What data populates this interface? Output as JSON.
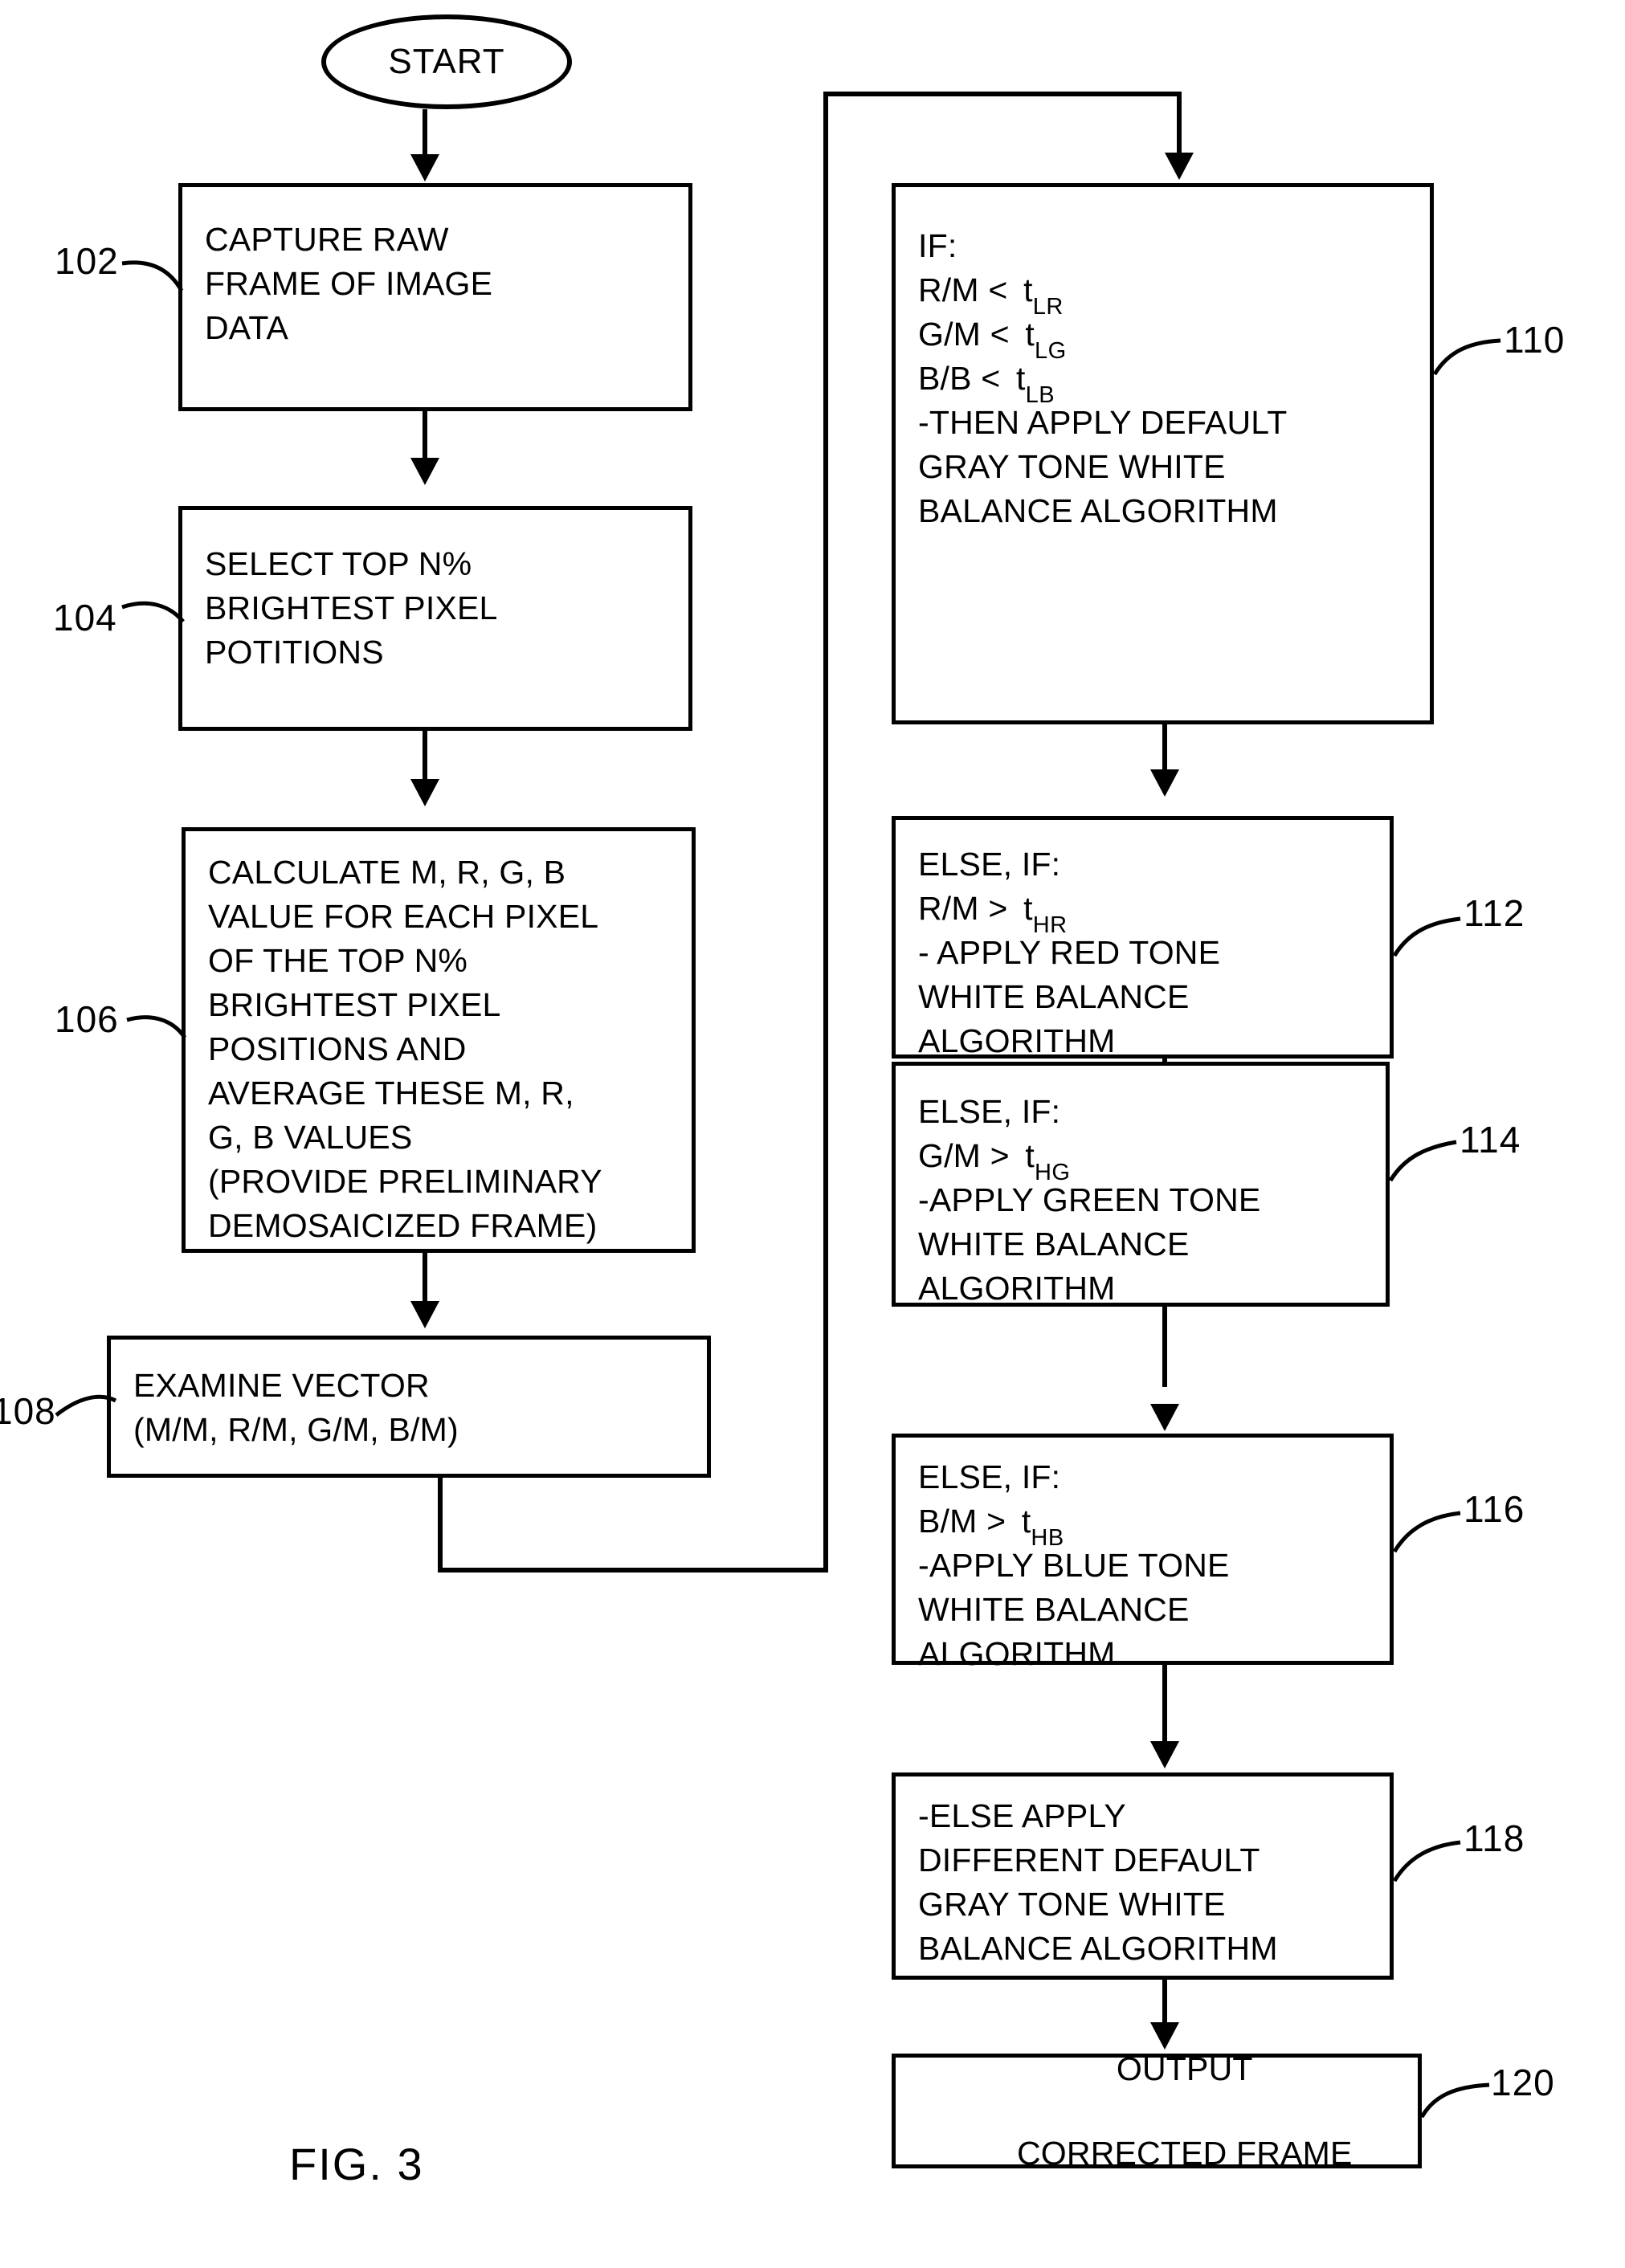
{
  "figure": {
    "caption": "FIG. 3"
  },
  "start_node": {
    "label": "START"
  },
  "left_column": [
    {
      "numeral": "102",
      "lines": [
        "CAPTURE RAW",
        "FRAME OF IMAGE",
        "DATA"
      ]
    },
    {
      "numeral": "104",
      "lines": [
        "SELECT TOP N%",
        "BRIGHTEST PIXEL",
        "POTITIONS"
      ]
    },
    {
      "numeral": "106",
      "lines": [
        "CALCULATE M, R, G, B",
        "VALUE FOR EACH PIXEL",
        "OF THE TOP N%",
        "BRIGHTEST PIXEL",
        "POSITIONS AND",
        "AVERAGE THESE M, R,",
        "G, B VALUES",
        "(PROVIDE PRELIMINARY",
        "DEMOSAICIZED FRAME)"
      ]
    },
    {
      "numeral": "108",
      "lines": [
        "EXAMINE VECTOR",
        "(M/M, R/M, G/M, B/M)"
      ]
    }
  ],
  "right_column": [
    {
      "numeral": "110",
      "lines": [
        {
          "text": "IF:"
        },
        {
          "text": "R/M < ",
          "t": "t",
          "sub": "LR"
        },
        {
          "text": "G/M < ",
          "t": "t",
          "sub": "LG"
        },
        {
          "text": "B/B < ",
          "t": "t",
          "sub": "LB"
        },
        {
          "text": "-THEN APPLY DEFAULT"
        },
        {
          "text": "GRAY TONE WHITE"
        },
        {
          "text": "BALANCE ALGORITHM"
        }
      ]
    },
    {
      "numeral": "112",
      "lines": [
        {
          "text": "ELSE, IF:"
        },
        {
          "text": "R/M > ",
          "t": "t",
          "sub": "HR"
        },
        {
          "text": "- APPLY RED TONE"
        },
        {
          "text": "WHITE BALANCE"
        },
        {
          "text": "ALGORITHM"
        }
      ]
    },
    {
      "numeral": "114",
      "lines": [
        {
          "text": "ELSE, IF:"
        },
        {
          "text": "G/M > ",
          "t": "t",
          "sub": "HG"
        },
        {
          "text": "-APPLY GREEN TONE"
        },
        {
          "text": "WHITE BALANCE"
        },
        {
          "text": "ALGORITHM"
        }
      ]
    },
    {
      "numeral": "116",
      "lines": [
        {
          "text": "ELSE, IF:"
        },
        {
          "text": "B/M > ",
          "t": "t",
          "sub": "HB"
        },
        {
          "text": "-APPLY BLUE TONE"
        },
        {
          "text": "WHITE BALANCE"
        },
        {
          "text": "ALGORITHM"
        }
      ]
    },
    {
      "numeral": "118",
      "lines": [
        {
          "text": "-ELSE APPLY"
        },
        {
          "text": "DIFFERENT DEFAULT"
        },
        {
          "text": "GRAY TONE WHITE"
        },
        {
          "text": "BALANCE ALGORITHM"
        }
      ]
    },
    {
      "numeral": "120",
      "lines": [
        {
          "text": "OUTPUT"
        },
        {
          "text": "CORRECTED FRAME"
        }
      ]
    }
  ],
  "colors": {
    "ink": "#000000",
    "paper": "#ffffff"
  }
}
